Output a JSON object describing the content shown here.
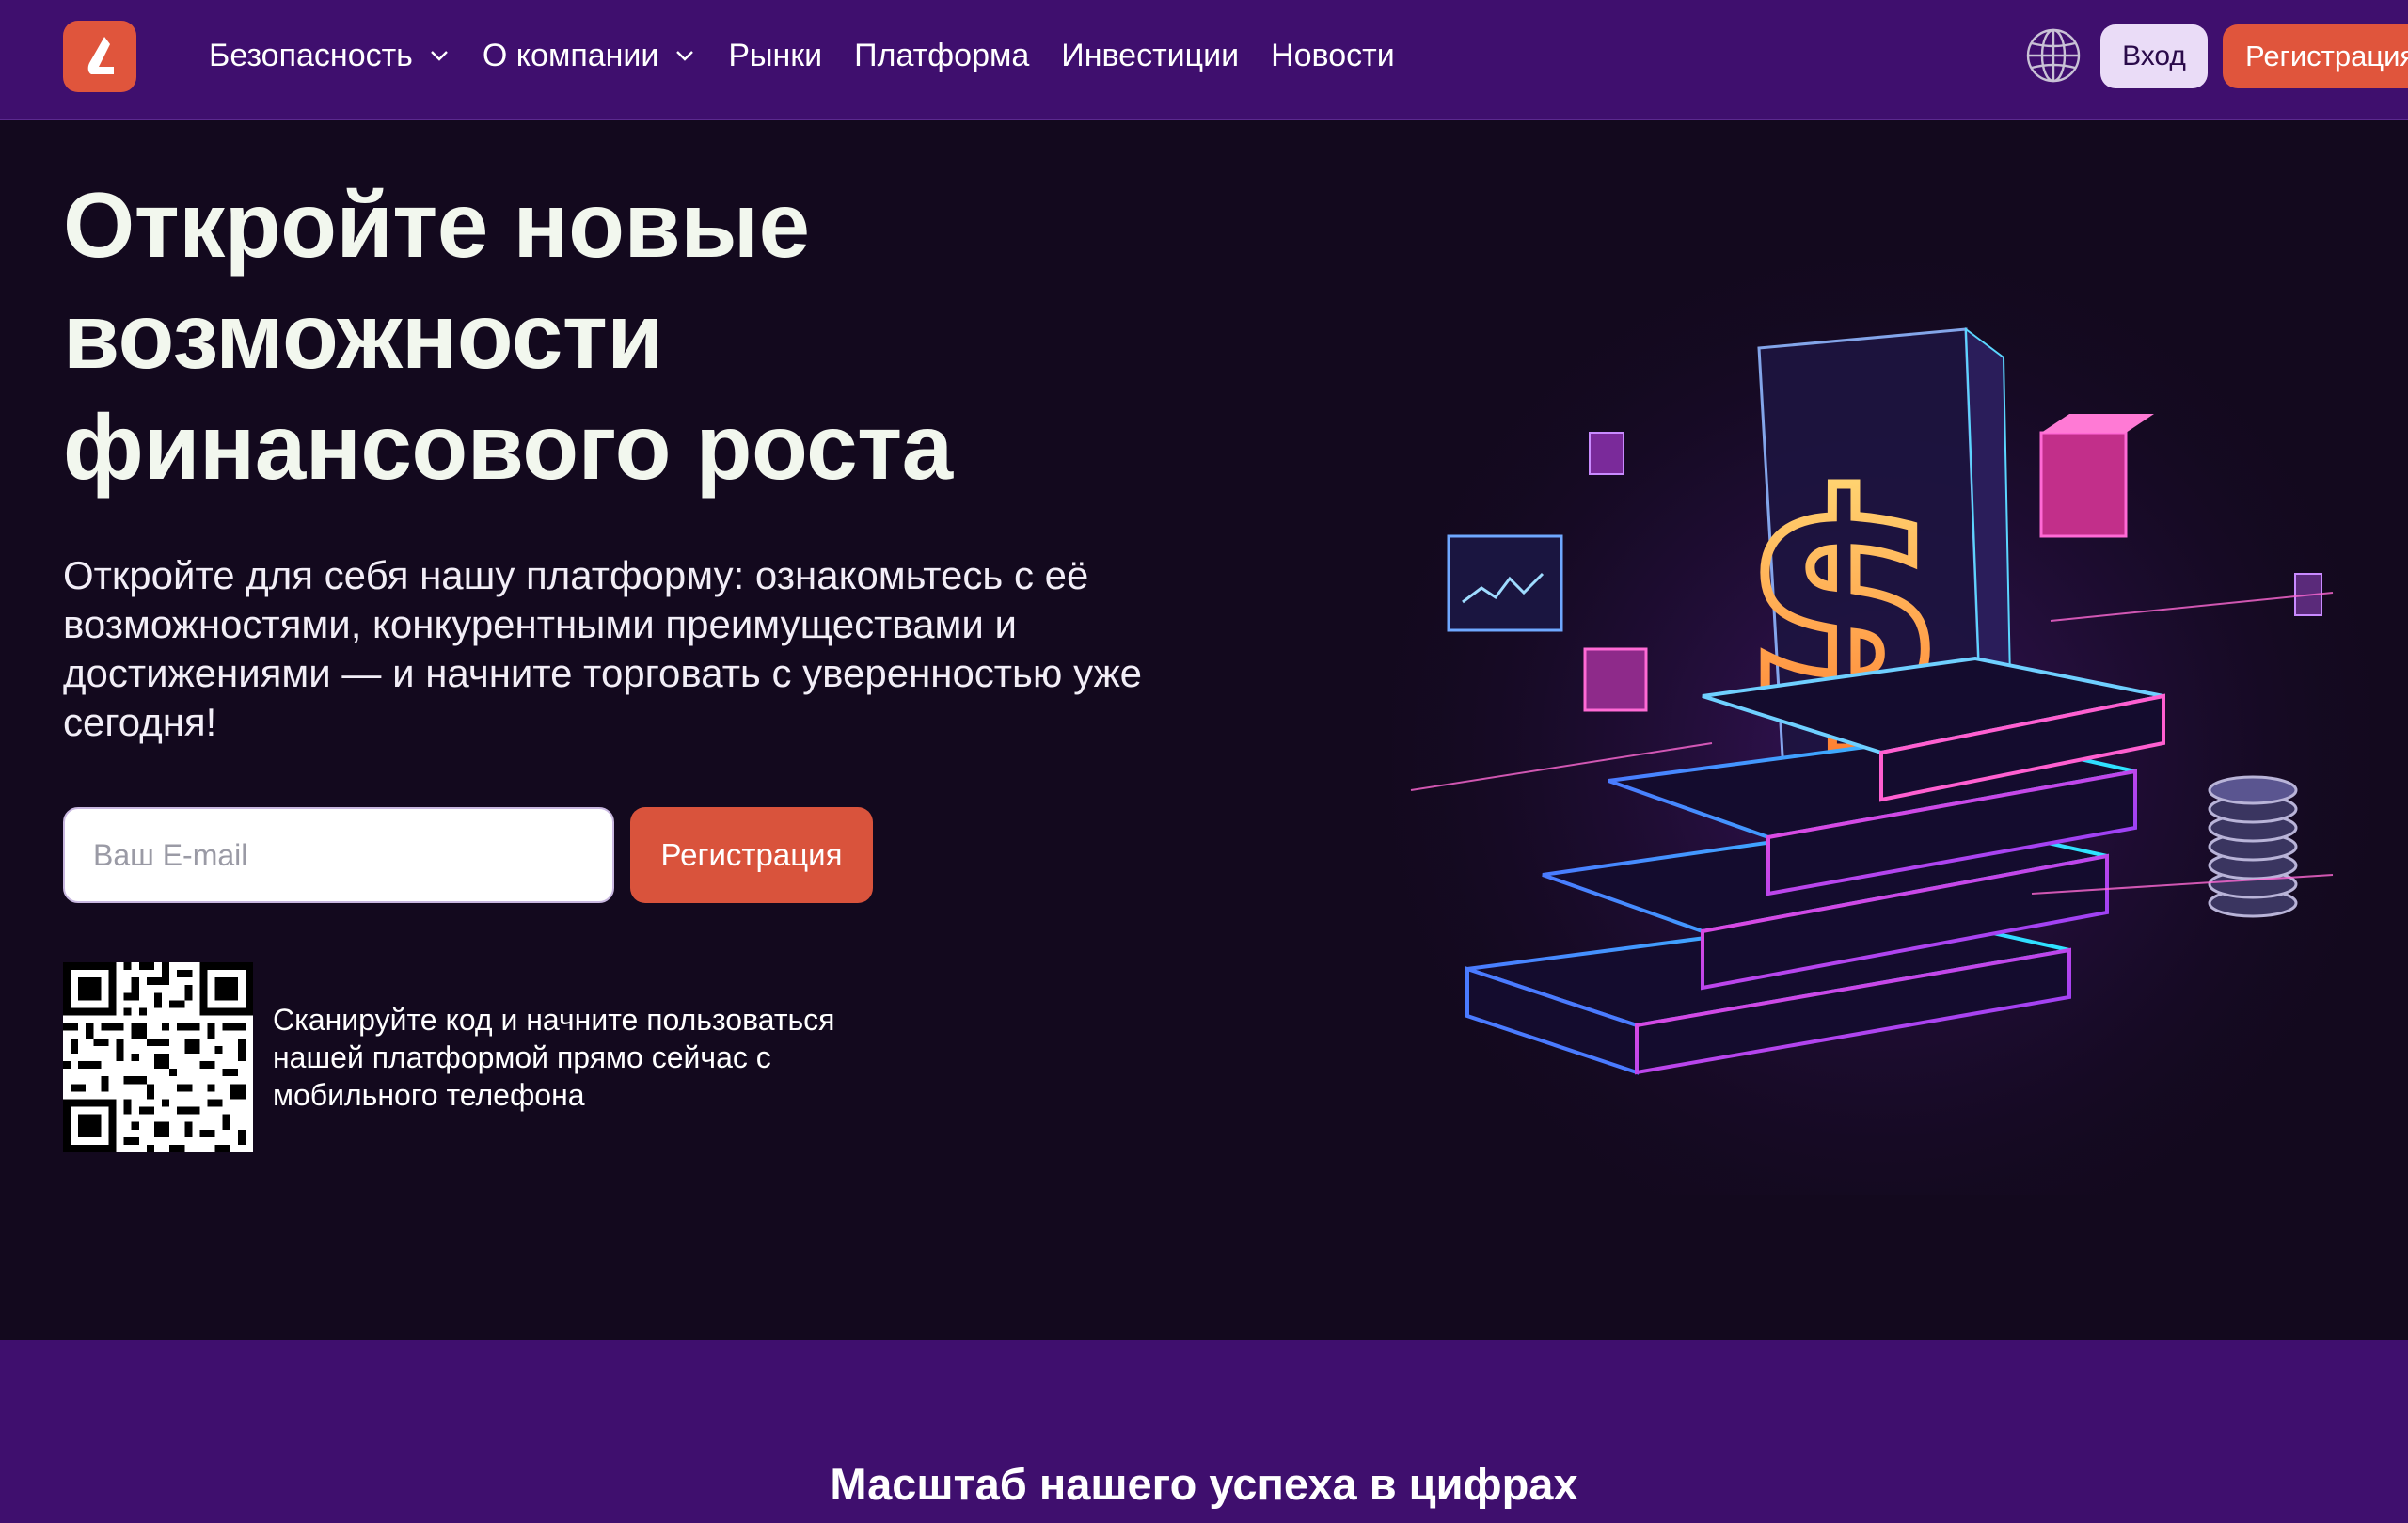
{
  "header": {
    "logo": "brand-logo",
    "nav": [
      {
        "label": "Безопасность",
        "has_dropdown": true
      },
      {
        "label": "О компании",
        "has_dropdown": true
      },
      {
        "label": "Рынки",
        "has_dropdown": false
      },
      {
        "label": "Платформа",
        "has_dropdown": false
      },
      {
        "label": "Инвестиции",
        "has_dropdown": false
      },
      {
        "label": "Новости",
        "has_dropdown": false
      }
    ],
    "language_icon": "globe-icon",
    "login_label": "Вход",
    "register_label": "Регистрация"
  },
  "hero": {
    "title": "Откройте новые возможности финансового роста",
    "subtitle": "Откройте для себя нашу платформу: ознакомьтесь с её возможностями, конкурентными преимуществами и достижениями — и начните торговать с уверенностью уже сегодня!",
    "email_placeholder": "Ваш E-mail",
    "register_button": "Регистрация",
    "qr_text": "Сканируйте код и начните пользоваться нашей платформой прямо сейчас с мобильного телефона"
  },
  "stats": {
    "title": "Масштаб нашего успеха в цифрах"
  },
  "colors": {
    "header_bg": "#3f0f6e",
    "hero_bg": "#13091e",
    "accent": "#e0553c",
    "login_bg": "#eadcf7"
  }
}
